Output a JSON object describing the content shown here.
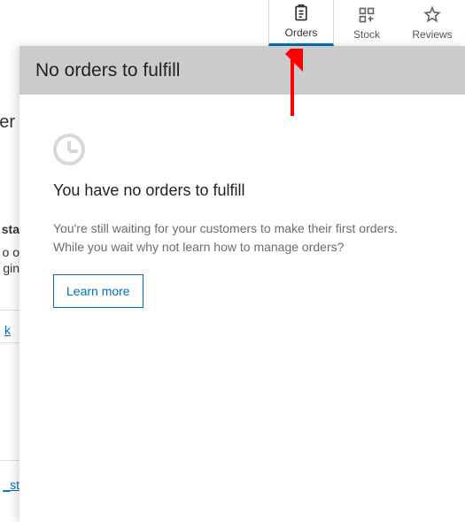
{
  "tabs": {
    "orders": "Orders",
    "stock": "Stock",
    "reviews": "Reviews"
  },
  "panel": {
    "header": "No orders to fulfill",
    "title": "You have no orders to fulfill",
    "description": "You're still waiting for your customers to make their first orders. While you wait why not learn how to manage orders?",
    "learn_more": "Learn more"
  },
  "bg": {
    "er": "er",
    "sta": "sta",
    "o_o": "o o",
    "gin": "gin",
    "k": "k",
    "st": "_st"
  },
  "icons": {
    "orders": "orders-icon",
    "stock": "stock-icon",
    "reviews": "reviews-icon",
    "clock": "clock-icon"
  }
}
